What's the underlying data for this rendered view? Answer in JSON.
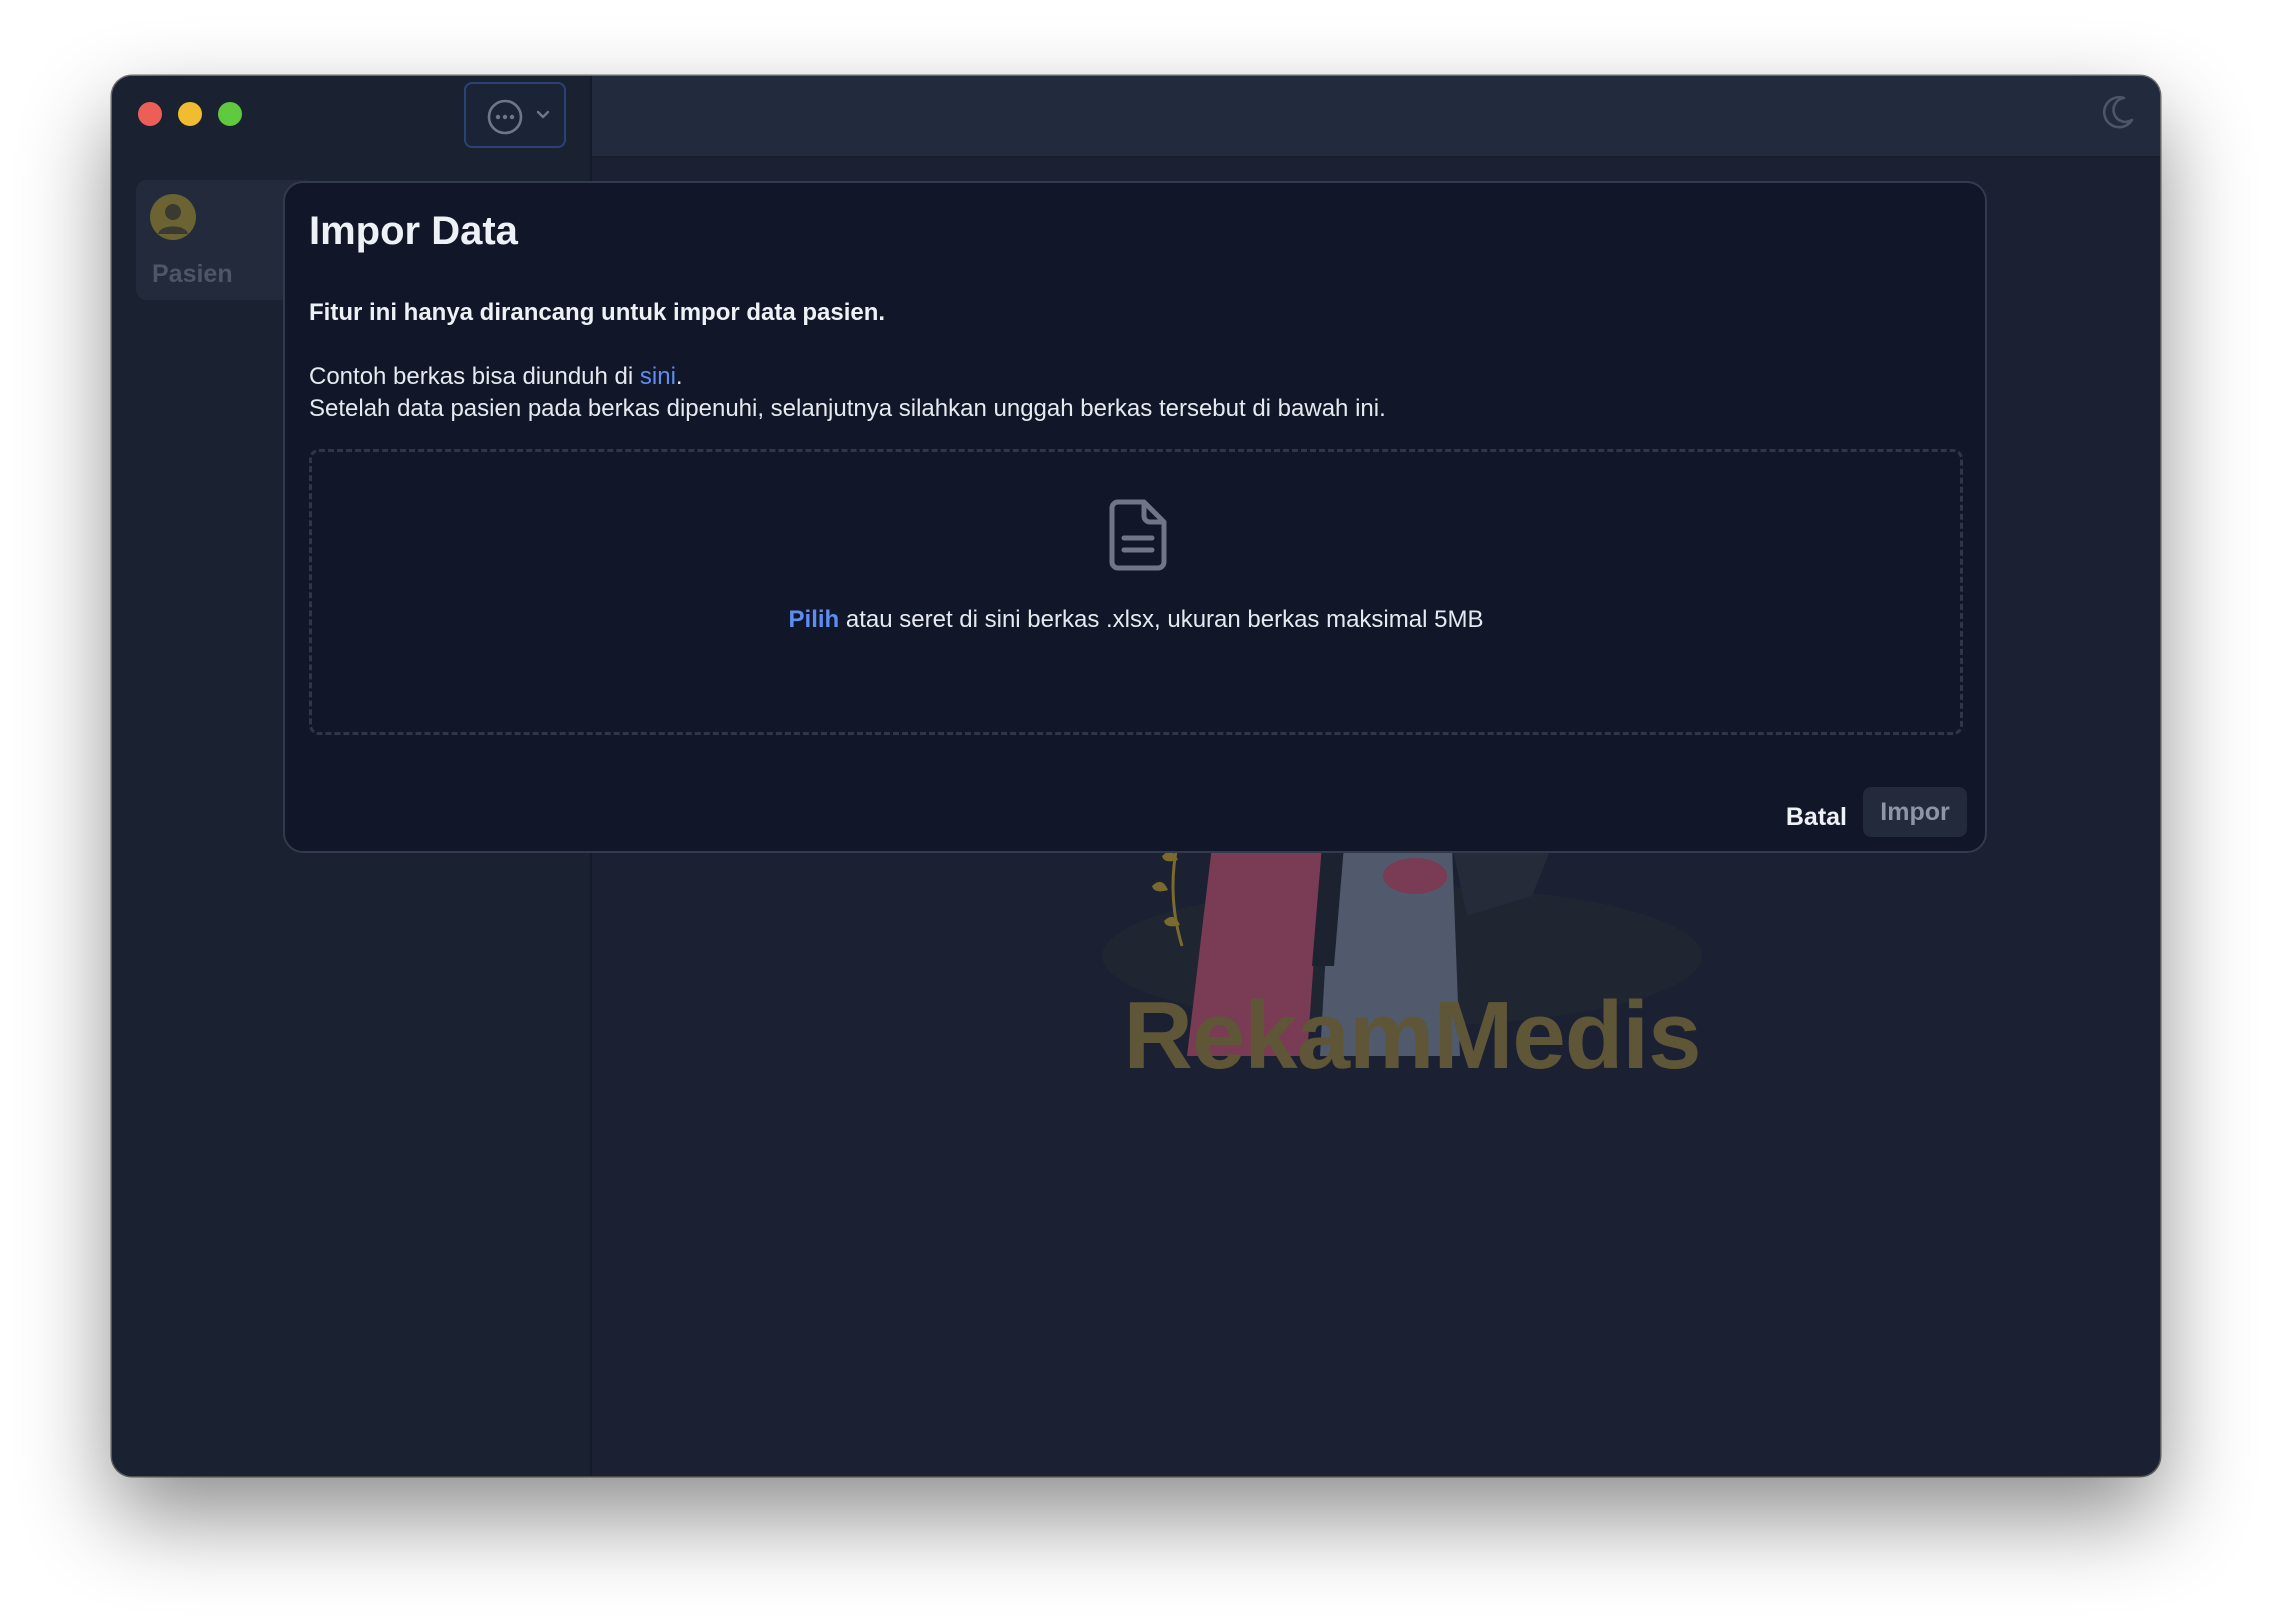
{
  "window": {
    "controls": [
      "close",
      "minimize",
      "maximize"
    ]
  },
  "toolbar": {
    "menu_icon": "ellipsis-circle-icon",
    "menu_chevron": "chevron-down-icon",
    "theme_icon": "moon-icon"
  },
  "sidebar": {
    "items": [
      {
        "label": "Pasien",
        "icon": "user-circle-icon",
        "active": true
      }
    ]
  },
  "background": {
    "brand_text": "RekamMedis"
  },
  "dialog": {
    "title": "Impor Data",
    "lead": "Fitur ini hanya dirancang untuk impor data pasien.",
    "example_prefix": "Contoh berkas bisa diunduh di ",
    "example_link": "sini",
    "example_suffix": ".",
    "instruction": "Setelah data pasien pada berkas dipenuhi, selanjutnya silahkan unggah berkas tersebut di bawah ini.",
    "dropzone": {
      "icon": "document-icon",
      "pick_link": "Pilih",
      "hint": " atau seret di sini berkas .xlsx, ukuran berkas maksimal 5MB"
    },
    "cancel_label": "Batal",
    "import_label": "Impor"
  },
  "colors": {
    "accent_link": "#5f8cf0",
    "dialog_bg": "#111728",
    "window_bg": "#1b2133"
  }
}
